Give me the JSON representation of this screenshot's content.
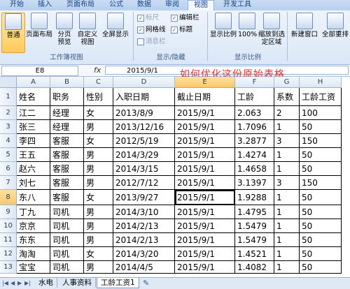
{
  "ribbon_tabs": [
    "开始",
    "插入",
    "页面布局",
    "公式",
    "数据",
    "审阅",
    "视图",
    "开发工具"
  ],
  "active_tab": "视图",
  "workbook_views": {
    "group_label": "工作簿视图",
    "buttons": [
      "普通",
      "页面布局",
      "分页预览",
      "自定义视图",
      "全屏显示"
    ]
  },
  "show_hide": {
    "group_label": "显示/隐藏",
    "checkboxes": [
      {
        "label": "标尺",
        "checked": true,
        "disabled": true
      },
      {
        "label": "编辑栏",
        "checked": true,
        "disabled": false
      },
      {
        "label": "网格线",
        "checked": true,
        "disabled": false
      },
      {
        "label": "标题",
        "checked": true,
        "disabled": false
      },
      {
        "label": "消息栏",
        "checked": false,
        "disabled": true
      }
    ]
  },
  "zoom": {
    "group_label": "显示比例",
    "buttons": [
      "显示比例",
      "100%",
      "缩放到选定区域"
    ]
  },
  "window": {
    "buttons": [
      "新建窗口",
      "全部重排"
    ]
  },
  "formula_bar": {
    "name_box": "E8",
    "fx": "fx",
    "value": "2015/9/1"
  },
  "overlay_text": "如何优化这份原始表格",
  "column_headers": [
    "A",
    "B",
    "C",
    "D",
    "E",
    "F",
    "G",
    "H"
  ],
  "active_column": "E",
  "active_row": 8,
  "rows": [
    [
      "姓名",
      "职务",
      "性别",
      "入职日期",
      "截止日期",
      "工龄",
      "系数",
      "工龄工资"
    ],
    [
      "江二",
      "经理",
      "女",
      "2013/8/9",
      "2015/9/1",
      "2.063",
      "2",
      "100"
    ],
    [
      "张三",
      "经理",
      "男",
      "2013/12/16",
      "2015/9/1",
      "1.7096",
      "1",
      "50"
    ],
    [
      "李四",
      "客服",
      "女",
      "2012/5/19",
      "2015/9/1",
      "3.2877",
      "3",
      "150"
    ],
    [
      "王五",
      "客服",
      "男",
      "2014/3/29",
      "2015/9/1",
      "1.4274",
      "1",
      "50"
    ],
    [
      "赵六",
      "客服",
      "男",
      "2014/3/15",
      "2015/9/1",
      "1.4658",
      "1",
      "50"
    ],
    [
      "刘七",
      "客服",
      "男",
      "2012/7/12",
      "2015/9/1",
      "3.1397",
      "3",
      "150"
    ],
    [
      "东八",
      "客服",
      "女",
      "2013/9/27",
      "2015/9/1",
      "1.9288",
      "1",
      "50"
    ],
    [
      "丁九",
      "司机",
      "男",
      "2014/3/10",
      "2015/9/1",
      "1.4795",
      "1",
      "50"
    ],
    [
      "京京",
      "司机",
      "男",
      "2014/2/13",
      "2015/9/1",
      "1.5479",
      "1",
      "50"
    ],
    [
      "东东",
      "司机",
      "男",
      "2014/2/13",
      "2015/9/1",
      "1.5479",
      "1",
      "50"
    ],
    [
      "淘淘",
      "司机",
      "女",
      "2014/3/20",
      "2015/9/1",
      "1.4521",
      "1",
      "50"
    ],
    [
      "宝宝",
      "司机",
      "男",
      "2014/4/5",
      "2015/9/1",
      "1.4082",
      "1",
      "50"
    ]
  ],
  "sheet_tabs": [
    "水电",
    "人事资料",
    "工龄工资1"
  ],
  "active_sheet": "工龄工资1"
}
